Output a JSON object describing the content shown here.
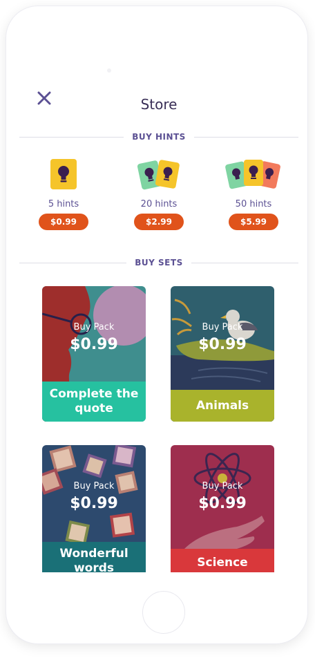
{
  "header": {
    "title": "Store",
    "close_icon": "close-icon"
  },
  "sections": {
    "hints_label": "BUY HINTS",
    "sets_label": "BUY SETS"
  },
  "hints": [
    {
      "count_label": "5 hints",
      "price": "$0.99"
    },
    {
      "count_label": "20 hints",
      "price": "$2.99"
    },
    {
      "count_label": "50 hints",
      "price": "$5.99"
    }
  ],
  "sets": [
    {
      "buy_label": "Buy Pack",
      "price": "$0.99",
      "name": "Complete the quote",
      "band_color": "#26c1a0"
    },
    {
      "buy_label": "Buy Pack",
      "price": "$0.99",
      "name": "Animals",
      "band_color": "#a9b32c"
    },
    {
      "buy_label": "Buy Pack",
      "price": "$0.99",
      "name": "Wonderful words",
      "band_color": "#1a7077"
    },
    {
      "buy_label": "Buy Pack",
      "price": "$0.99",
      "name": "Science",
      "band_color": "#d9383b"
    }
  ],
  "colors": {
    "accent": "#5b5093",
    "price_pill": "#e0531b",
    "title": "#3a2f57"
  }
}
